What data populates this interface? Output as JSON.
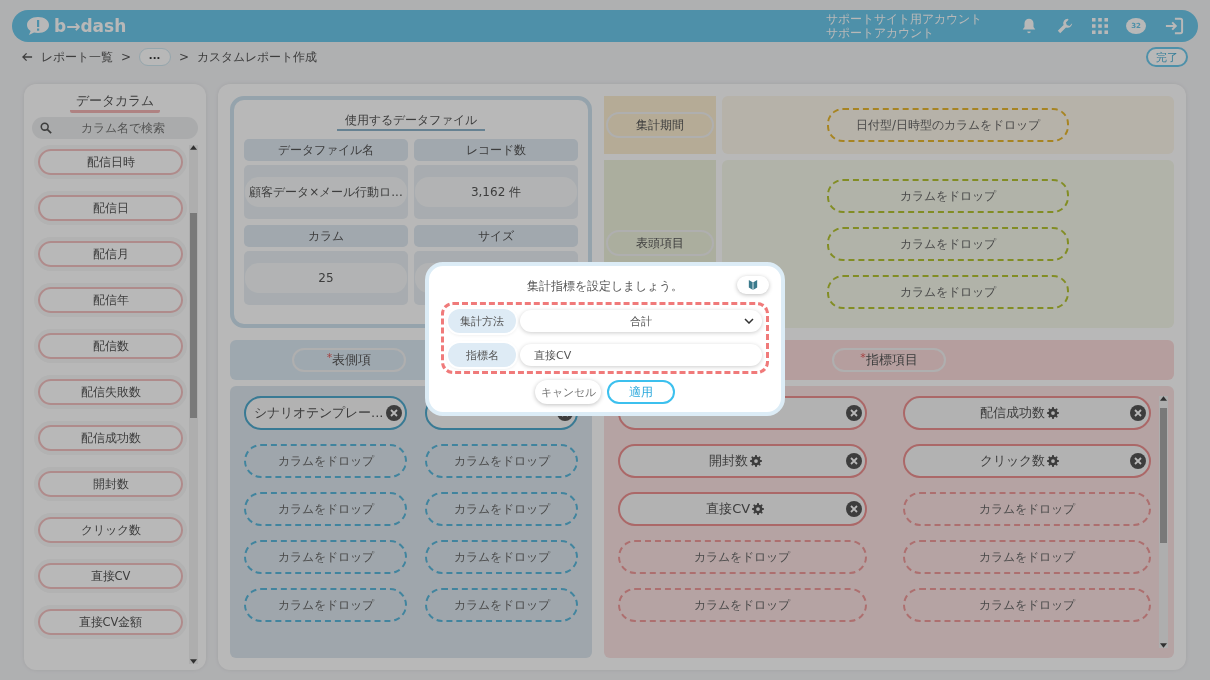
{
  "header": {
    "logo": "b→dash",
    "account_lines": [
      "サポートサイト用アカウント",
      "サポートアカウント"
    ],
    "chat_badge": "32"
  },
  "breadcrumb": {
    "items": [
      {
        "kind": "link",
        "text": "レポート一覧"
      },
      {
        "kind": "sep",
        "text": ">"
      },
      {
        "kind": "more",
        "text": "•••"
      },
      {
        "kind": "sep",
        "text": ">"
      },
      {
        "kind": "current",
        "text": "カスタムレポート作成"
      }
    ],
    "done_button": "完了"
  },
  "sidebar": {
    "title": "データカラム",
    "search": {
      "placeholder": "カラム名で検索"
    },
    "columns": [
      "配信日時",
      "配信日",
      "配信月",
      "配信年",
      "配信数",
      "配信失敗数",
      "配信成功数",
      "開封数",
      "クリック数",
      "直接CV",
      "直接CV金額"
    ]
  },
  "data_file": {
    "title": "使用するデータファイル",
    "fields": [
      {
        "label": "データファイル名",
        "value": "顧客データ×メール行動ロ..."
      },
      {
        "label": "レコード数",
        "value": "3,162 件"
      },
      {
        "label": "カラム",
        "value": "25"
      },
      {
        "label": "サイズ"
      }
    ]
  },
  "period": {
    "label": "集計期間",
    "drops": [
      "日付型/日時型のカラムをドロップ"
    ]
  },
  "header_items": {
    "label": "表頭項目",
    "drops": [
      "カラムをドロップ",
      "カラムをドロップ",
      "カラムをドロップ"
    ]
  },
  "row_items": {
    "label": "表側項",
    "required_mark": "*",
    "chips": [
      {
        "kind": "column",
        "text": "シナリオテンプレー..."
      },
      {
        "kind": "column"
      },
      {
        "kind": "drop",
        "text": "カラムをドロップ"
      },
      {
        "kind": "drop",
        "text": "カラムをドロップ"
      },
      {
        "kind": "drop",
        "text": "カラムをドロップ"
      },
      {
        "kind": "drop",
        "text": "カラムをドロップ"
      },
      {
        "kind": "drop",
        "text": "カラムをドロップ"
      },
      {
        "kind": "drop",
        "text": "カラムをドロップ"
      },
      {
        "kind": "drop",
        "text": "カラムをドロップ"
      },
      {
        "kind": "drop",
        "text": "カラムをドロップ"
      }
    ]
  },
  "metrics": {
    "label": "指標項目",
    "required_mark": "*",
    "chips": [
      {
        "kind": "column"
      },
      {
        "kind": "column",
        "text": "配信成功数"
      },
      {
        "kind": "column",
        "text": "開封数"
      },
      {
        "kind": "column",
        "text": "クリック数"
      },
      {
        "kind": "column",
        "text": "直接CV"
      },
      {
        "kind": "drop",
        "text": "カラムをドロップ"
      },
      {
        "kind": "drop",
        "text": "カラムをドロップ"
      },
      {
        "kind": "drop",
        "text": "カラムをドロップ"
      },
      {
        "kind": "drop",
        "text": "カラムをドロップ"
      },
      {
        "kind": "drop",
        "text": "カラムをドロップ"
      }
    ]
  },
  "dialog": {
    "title": "集計指標を設定しましょう。",
    "fields": [
      {
        "label": "集計方法",
        "kind": "select",
        "value": "合計"
      },
      {
        "label": "指標名",
        "kind": "input",
        "value": "直接CV"
      }
    ],
    "buttons": [
      {
        "label": "キャンセル",
        "primary": false
      },
      {
        "label": "適用",
        "primary": true
      }
    ]
  }
}
